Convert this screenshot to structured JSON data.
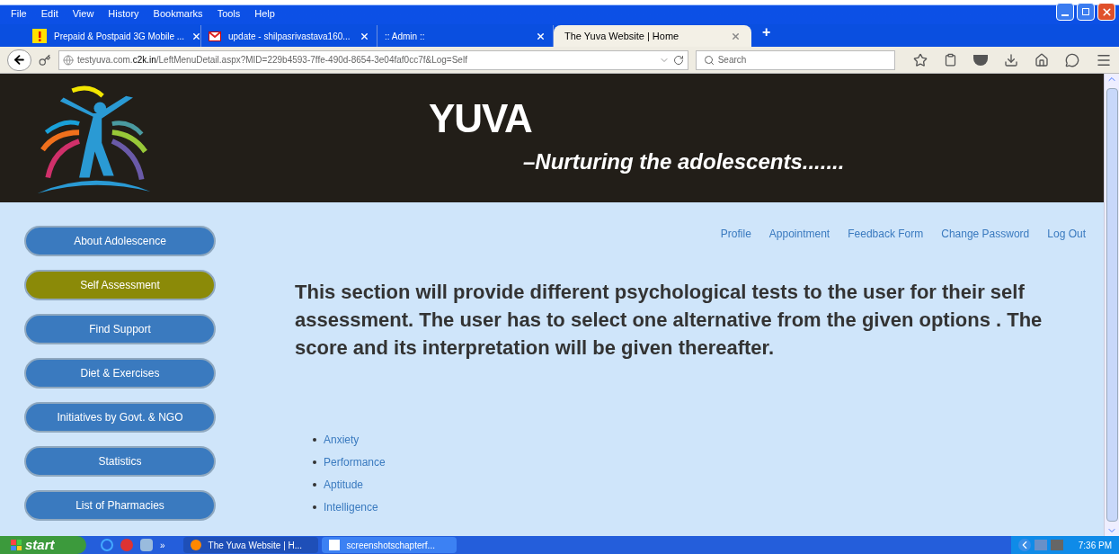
{
  "menu_bar": [
    "File",
    "Edit",
    "View",
    "History",
    "Bookmarks",
    "Tools",
    "Help"
  ],
  "tabs": [
    {
      "label": "Prepaid & Postpaid 3G Mobile ...",
      "kind": "warning",
      "selected": false
    },
    {
      "label": "update - shilpasrivastava160...",
      "kind": "mail",
      "selected": false
    },
    {
      "label": ":: Admin ::",
      "kind": "plain",
      "selected": false
    },
    {
      "label": "The Yuva Website | Home",
      "kind": "plain",
      "selected": true
    }
  ],
  "new_tab": "+",
  "address_bar": {
    "url_prefix": "testyuva.com.",
    "url_domain": "c2k.in",
    "url_path": "/LeftMenuDetail.aspx?MID=229b4593-7ffe-490d-8654-3e04faf0cc7f&Log=Self"
  },
  "search": {
    "placeholder": "Search"
  },
  "site": {
    "title": "YUVA",
    "tagline": "–Nurturing the adolescents......."
  },
  "sidebar": [
    {
      "label": "About Adolescence",
      "selected": false
    },
    {
      "label": "Self Assessment",
      "selected": true
    },
    {
      "label": "Find Support",
      "selected": false
    },
    {
      "label": "Diet & Exercises",
      "selected": false
    },
    {
      "label": "Initiatives by Govt. & NGO",
      "selected": false
    },
    {
      "label": "Statistics",
      "selected": false
    },
    {
      "label": "List of Pharmacies",
      "selected": false
    }
  ],
  "top_links": [
    "Profile",
    "Appointment",
    "Feedback Form",
    "Change Password",
    "Log Out"
  ],
  "intro": "This section will provide different psychological tests to the user for their self assessment. The user has to select one alternative from the given options . The score and its interpretation will be given thereafter.",
  "tests": [
    "Anxiety",
    "Performance",
    "Aptitude",
    "Intelligence"
  ],
  "taskbar": {
    "start": "start",
    "more": "»",
    "windows": [
      {
        "label": "The Yuva Website | H...",
        "selected": true
      },
      {
        "label": "screenshotschapterf...",
        "selected": false
      }
    ],
    "clock": "7:36 PM"
  }
}
